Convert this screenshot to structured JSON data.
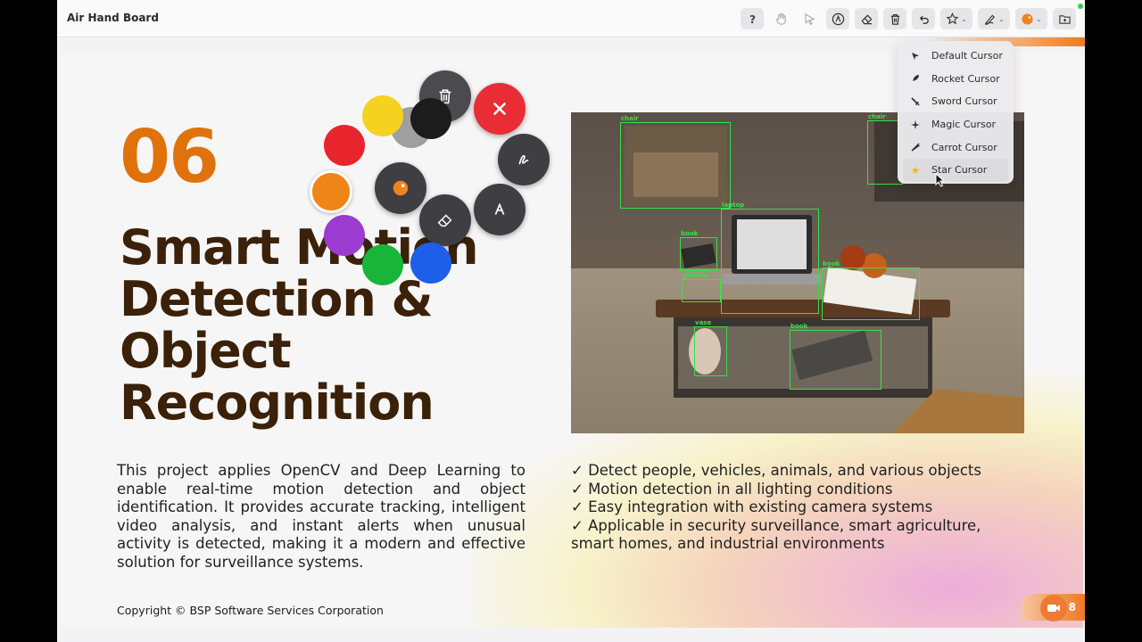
{
  "app": {
    "title": "Air Hand Board"
  },
  "toolbar": {
    "buttons": [
      {
        "name": "help-button",
        "icon": "question-icon"
      },
      {
        "name": "hand-button",
        "icon": "hand-icon"
      },
      {
        "name": "pointer-button",
        "icon": "arrow-pointer-icon"
      },
      {
        "name": "marker-button",
        "icon": "marker-icon"
      },
      {
        "name": "eraser-button",
        "icon": "eraser-icon"
      },
      {
        "name": "delete-button",
        "icon": "trash-icon"
      },
      {
        "name": "undo-button",
        "icon": "undo-icon"
      },
      {
        "name": "cursor-select-button",
        "icon": "cursor-icon"
      },
      {
        "name": "pen-select-button",
        "icon": "pen-icon"
      },
      {
        "name": "color-select-button",
        "icon": "palette-icon"
      },
      {
        "name": "folder-button",
        "icon": "folder-icon"
      }
    ]
  },
  "slide": {
    "number": "06",
    "title_lines": [
      "Smart Motion",
      "Detection &",
      "Object",
      "Recognition"
    ],
    "description": "This project applies OpenCV and Deep Learning to enable real-time motion detection and object identification. It provides accurate tracking, intelligent video analysis, and instant alerts when unusual activity is detected, making it a modern and effective solution for surveillance systems.",
    "features": [
      "✓ Detect people, vehicles, animals, and various objects",
      "✓ Motion detection in all lighting conditions",
      "✓ Easy integration with existing camera systems",
      "✓ Applicable in security surveillance, smart agriculture,\nsmart homes, and industrial environments"
    ],
    "copyright": "Copyright © BSP Software Services Corporation",
    "page_badge": "P    8",
    "detections": [
      {
        "label": "chair"
      },
      {
        "label": "chair"
      },
      {
        "label": "book"
      },
      {
        "label": "laptop"
      },
      {
        "label": "glasses"
      },
      {
        "label": "book"
      },
      {
        "label": "vase"
      },
      {
        "label": "book"
      }
    ]
  },
  "radial_menu": {
    "colors": [
      "#f4d21f",
      "#1c1c1c",
      "#e8252d",
      "#ef8417",
      "#9b3bd0",
      "#19b53a",
      "#1d5fe8"
    ],
    "tools": [
      "trash-icon",
      "close-icon",
      "pen-icon",
      "marker-icon",
      "eraser-icon",
      "palette-icon"
    ]
  },
  "cursor_menu": {
    "items": [
      {
        "label": "Default Cursor",
        "icon": "arrow-cursor-icon"
      },
      {
        "label": "Rocket Cursor",
        "icon": "rocket-icon"
      },
      {
        "label": "Sword Cursor",
        "icon": "sword-icon"
      },
      {
        "label": "Magic Cursor",
        "icon": "magic-icon"
      },
      {
        "label": "Carrot Cursor",
        "icon": "carrot-icon"
      },
      {
        "label": "Star Cursor",
        "icon": "star-icon"
      }
    ],
    "selected": "Star Cursor",
    "star_color": "#f5b820"
  },
  "colors": {
    "accent": "#e0720c",
    "title": "#3b2109",
    "detection": "#38e047"
  }
}
